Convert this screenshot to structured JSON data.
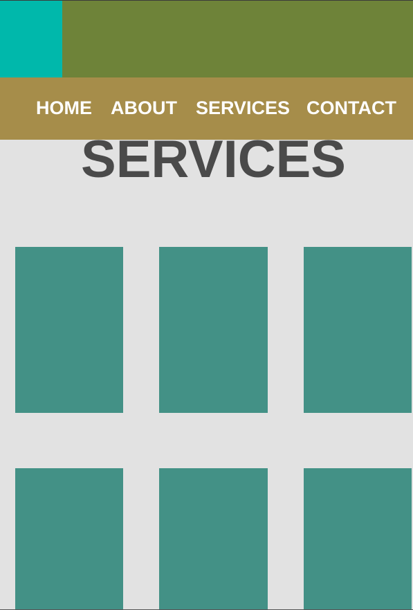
{
  "colors": {
    "logo": "#00b8ab",
    "banner": "#6e8339",
    "nav": "#a68d4a",
    "nav_text": "#ffffff",
    "background": "#e2e2e2",
    "title": "#4a4a4a",
    "card": "#439186"
  },
  "nav": {
    "items": [
      {
        "label": "HOME"
      },
      {
        "label": "ABOUT"
      },
      {
        "label": "SERVICES"
      },
      {
        "label": "CONTACT"
      }
    ]
  },
  "main": {
    "title": "SERVICES"
  }
}
